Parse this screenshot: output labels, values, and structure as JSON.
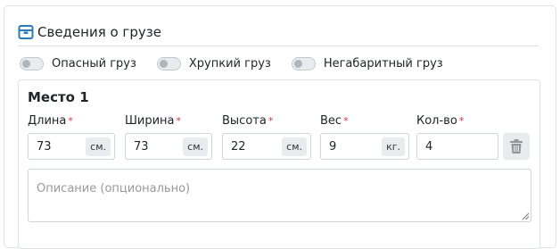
{
  "section": {
    "title": "Сведения о грузе",
    "icon": "box-icon"
  },
  "toggles": [
    {
      "label": "Опасный груз",
      "on": false
    },
    {
      "label": "Хрупкий груз",
      "on": false
    },
    {
      "label": "Негабаритный груз",
      "on": false
    }
  ],
  "place": {
    "title": "Место 1",
    "fields": [
      {
        "label": "Длина",
        "value": "73",
        "unit": "см."
      },
      {
        "label": "Ширина",
        "value": "73",
        "unit": "см."
      },
      {
        "label": "Высота",
        "value": "22",
        "unit": "см."
      },
      {
        "label": "Вес",
        "value": "9",
        "unit": "кг."
      },
      {
        "label": "Кол-во",
        "value": "4",
        "unit": ""
      }
    ],
    "required_mark": "*",
    "description_placeholder": "Описание (опционально)"
  },
  "colors": {
    "accent": "#2a7bb8",
    "required": "#dc3545",
    "border": "#dee2e6"
  }
}
